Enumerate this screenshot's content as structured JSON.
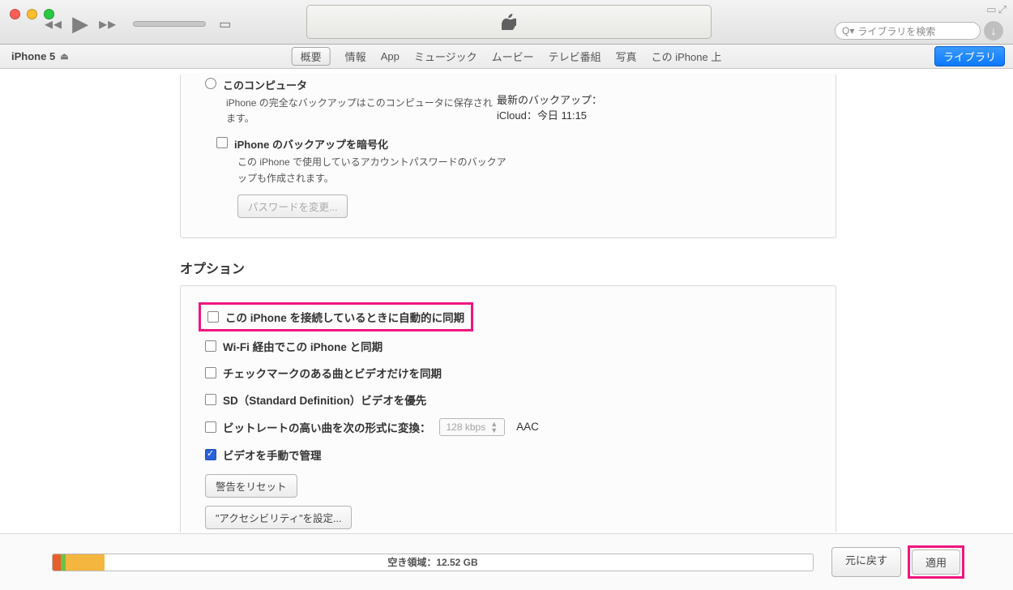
{
  "chrome": {
    "search_placeholder": "ライブラリを検索"
  },
  "tabbar": {
    "device": "iPhone 5",
    "tabs": {
      "summary": "概要",
      "info": "情報",
      "app": "App",
      "music": "ミュージック",
      "movie": "ムービー",
      "tv": "テレビ番組",
      "photo": "写真",
      "onthis": "この iPhone 上"
    },
    "library": "ライブラリ"
  },
  "backup": {
    "this_computer": "このコンピュータ",
    "this_computer_desc": "iPhone の完全なバックアップはこのコンピュータに保存されます。",
    "encrypt": "iPhone のバックアップを暗号化",
    "encrypt_desc": "この iPhone で使用しているアカウントパスワードのバックアップも作成されます。",
    "change_pw": "パスワードを変更...",
    "latest_h": "最新のバックアップ：",
    "latest_v": "iCloud：今日 11:15"
  },
  "options": {
    "header": "オプション",
    "auto_sync": "この iPhone を接続しているときに自動的に同期",
    "wifi_sync": "Wi-Fi 経由でこの iPhone と同期",
    "checked_only": "チェックマークのある曲とビデオだけを同期",
    "sd_pref": "SD（Standard Definition）ビデオを優先",
    "bitrate_label": "ビットレートの高い曲を次の形式に変換：",
    "bitrate_value": "128 kbps",
    "bitrate_fmt": "AAC",
    "manual_video": "ビデオを手動で管理",
    "reset_warn": "警告をリセット",
    "accessibility": "\"アクセシビリティ\"を設定..."
  },
  "bottom": {
    "free_label": "空き領域：12.52 GB",
    "revert": "元に戻す",
    "apply": "適用"
  }
}
